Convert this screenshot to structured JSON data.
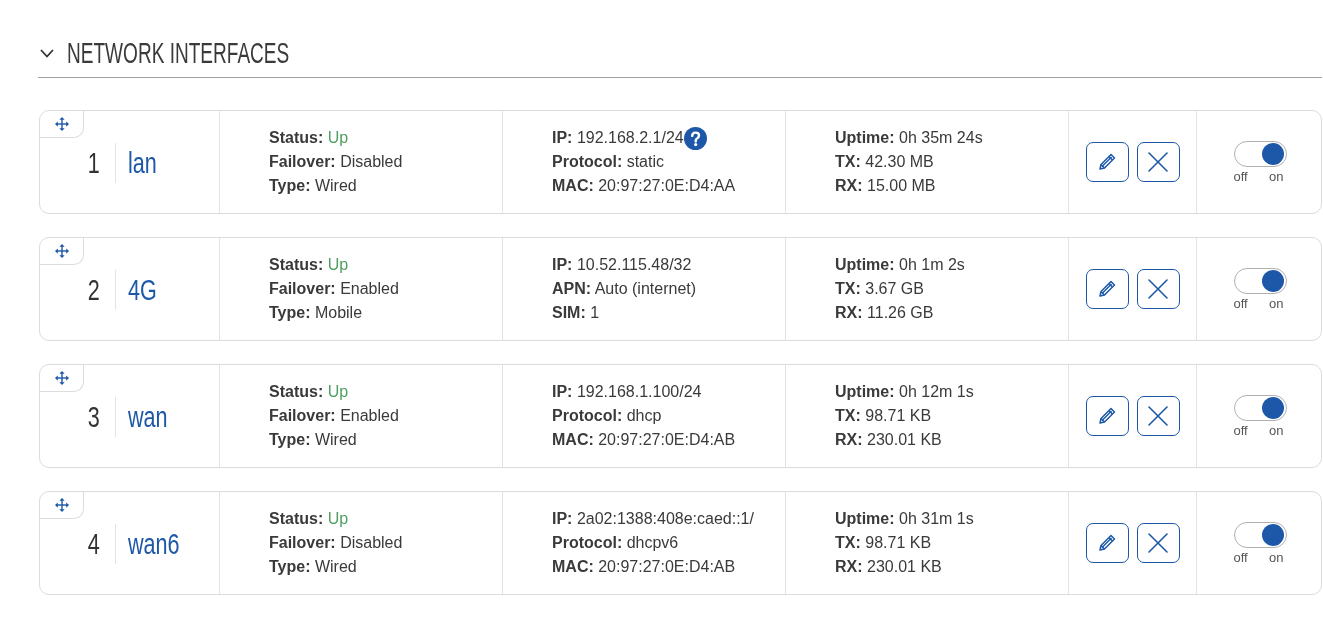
{
  "section": {
    "title": "NETWORK INTERFACES",
    "expanded": true
  },
  "interfaces": [
    {
      "number": "1",
      "name": "lan",
      "details": [
        [
          {
            "kind": "status",
            "label": "Status:",
            "value": "Up"
          },
          {
            "kind": "plain",
            "label": "Failover:",
            "value": "Disabled"
          },
          {
            "kind": "plain",
            "label": "Type:",
            "value": "Wired"
          }
        ],
        [
          {
            "kind": "help",
            "label": "IP:",
            "value": "192.168.2.1/24"
          },
          {
            "kind": "plain",
            "label": "Protocol:",
            "value": "static"
          },
          {
            "kind": "plain",
            "label": "MAC:",
            "value": "20:97:27:0E:D4:AA"
          }
        ],
        [
          {
            "kind": "plain",
            "label": "Uptime:",
            "value": "0h 35m 24s"
          },
          {
            "kind": "plain",
            "label": "TX:",
            "value": "42.30 MB"
          },
          {
            "kind": "plain",
            "label": "RX:",
            "value": "15.00 MB"
          }
        ]
      ],
      "enabled": true,
      "switch_labels": [
        "off",
        "on"
      ]
    },
    {
      "number": "2",
      "name": "4G",
      "details": [
        [
          {
            "kind": "status",
            "label": "Status:",
            "value": "Up"
          },
          {
            "kind": "plain",
            "label": "Failover:",
            "value": "Enabled"
          },
          {
            "kind": "plain",
            "label": "Type:",
            "value": "Mobile"
          }
        ],
        [
          {
            "kind": "plain",
            "label": "IP:",
            "value": "10.52.115.48/32"
          },
          {
            "kind": "plain",
            "label": "APN:",
            "value": "Auto (internet)"
          },
          {
            "kind": "plain",
            "label": "SIM:",
            "value": "1"
          }
        ],
        [
          {
            "kind": "plain",
            "label": "Uptime:",
            "value": "0h 1m 2s"
          },
          {
            "kind": "plain",
            "label": "TX:",
            "value": "3.67 GB"
          },
          {
            "kind": "plain",
            "label": "RX:",
            "value": "11.26 GB"
          }
        ]
      ],
      "enabled": true,
      "switch_labels": [
        "off",
        "on"
      ]
    },
    {
      "number": "3",
      "name": "wan",
      "details": [
        [
          {
            "kind": "status",
            "label": "Status:",
            "value": "Up"
          },
          {
            "kind": "plain",
            "label": "Failover:",
            "value": "Enabled"
          },
          {
            "kind": "plain",
            "label": "Type:",
            "value": "Wired"
          }
        ],
        [
          {
            "kind": "plain",
            "label": "IP:",
            "value": "192.168.1.100/24"
          },
          {
            "kind": "plain",
            "label": "Protocol:",
            "value": "dhcp"
          },
          {
            "kind": "plain",
            "label": "MAC:",
            "value": "20:97:27:0E:D4:AB"
          }
        ],
        [
          {
            "kind": "plain",
            "label": "Uptime:",
            "value": "0h 12m 1s"
          },
          {
            "kind": "plain",
            "label": "TX:",
            "value": "98.71 KB"
          },
          {
            "kind": "plain",
            "label": "RX:",
            "value": "230.01 KB"
          }
        ]
      ],
      "enabled": true,
      "switch_labels": [
        "off",
        "on"
      ]
    },
    {
      "number": "4",
      "name": "wan6",
      "details": [
        [
          {
            "kind": "status",
            "label": "Status:",
            "value": "Up"
          },
          {
            "kind": "plain",
            "label": "Failover:",
            "value": "Disabled"
          },
          {
            "kind": "plain",
            "label": "Type:",
            "value": "Wired"
          }
        ],
        [
          {
            "kind": "plain",
            "label": "IP:",
            "value": "2a02:1388:408e:caed::1/"
          },
          {
            "kind": "plain",
            "label": "Protocol:",
            "value": "dhcpv6"
          },
          {
            "kind": "plain",
            "label": "MAC:",
            "value": "20:97:27:0E:D4:AB"
          }
        ],
        [
          {
            "kind": "plain",
            "label": "Uptime:",
            "value": "0h 31m 1s"
          },
          {
            "kind": "plain",
            "label": "TX:",
            "value": "98.71 KB"
          },
          {
            "kind": "plain",
            "label": "RX:",
            "value": "230.01 KB"
          }
        ]
      ],
      "enabled": true,
      "switch_labels": [
        "off",
        "on"
      ]
    }
  ]
}
